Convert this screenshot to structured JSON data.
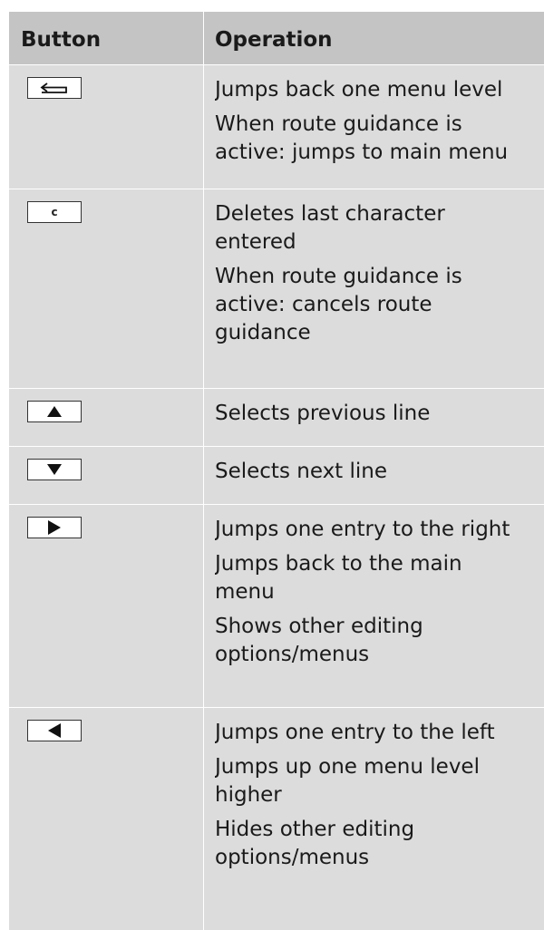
{
  "header": {
    "button": "Button",
    "operation": "Operation"
  },
  "rows": [
    {
      "key_icon": "back-arrow-icon",
      "lines": [
        "Jumps back one menu level",
        "When route guidance is",
        "active: jumps to main menu"
      ]
    },
    {
      "key_icon": "c-key-icon",
      "key_label": "c",
      "lines": [
        "Deletes last character",
        "entered",
        "When route guidance is",
        "active: cancels route",
        "guidance"
      ]
    },
    {
      "key_icon": "up-triangle-icon",
      "lines": [
        "Selects previous line"
      ]
    },
    {
      "key_icon": "down-triangle-icon",
      "lines": [
        "Selects next line"
      ]
    },
    {
      "key_icon": "right-triangle-icon",
      "lines": [
        "Jumps one entry to the right",
        "Jumps back to the main",
        "menu",
        "Shows other editing",
        "options/menus"
      ]
    },
    {
      "key_icon": "left-triangle-icon",
      "lines": [
        "Jumps one entry to the left",
        "Jumps up one menu level",
        "higher",
        "Hides other editing",
        "options/menus"
      ]
    }
  ]
}
